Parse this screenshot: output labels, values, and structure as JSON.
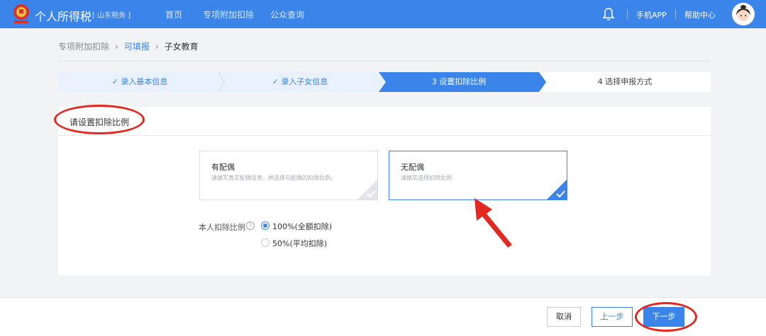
{
  "header": {
    "app_title": "个人所得税",
    "region": "[ 山东税务 ]",
    "nav": [
      "首页",
      "专项附加扣除",
      "公众查询"
    ],
    "links": [
      "手机APP",
      "帮助中心"
    ],
    "brand_color": "#3b84ea"
  },
  "breadcrumb": {
    "items": [
      "专项附加扣除",
      "可填报",
      "子女教育"
    ]
  },
  "steps": [
    {
      "label": "✓ 录入基本信息",
      "state": "done"
    },
    {
      "label": "✓ 录入子女信息",
      "state": "done"
    },
    {
      "label": "3 设置扣除比例",
      "state": "active"
    },
    {
      "label": "4 选择申报方式",
      "state": "todo"
    }
  ],
  "panel": {
    "title": "请设置扣除比例",
    "cards": [
      {
        "title": "有配偶",
        "desc": "请填写真实配偶信息，并选择与配偶的扣除比例。",
        "selected": false
      },
      {
        "title": "无配偶",
        "desc": "请据实选择扣除比例",
        "selected": true
      }
    ],
    "ratio": {
      "label": "本人扣除比例",
      "help_icon": "question-icon",
      "options": [
        {
          "label": "100%(全额扣除)",
          "checked": true
        },
        {
          "label": "50%(平均扣除)",
          "checked": false
        }
      ]
    }
  },
  "footer": {
    "cancel": "取消",
    "prev": "上一步",
    "next": "下一步"
  },
  "annotation_color": "#e5281f"
}
